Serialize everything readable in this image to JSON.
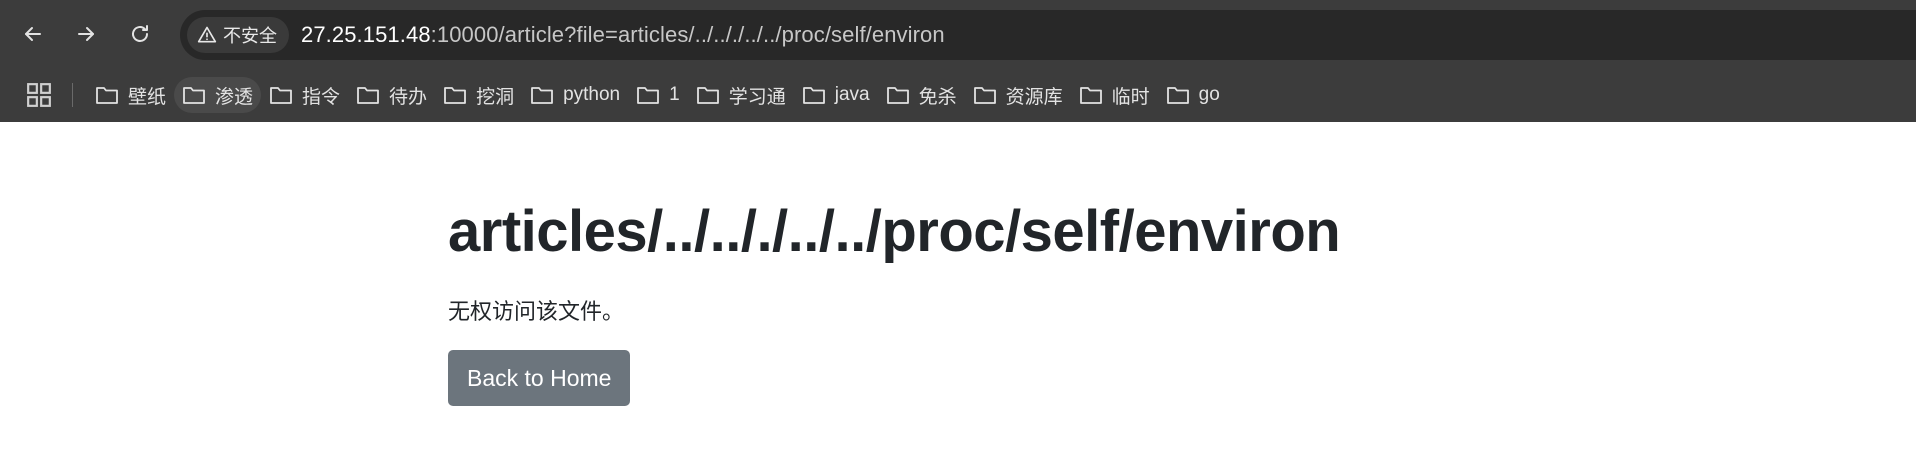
{
  "browser": {
    "security_label": "不安全",
    "url_host": "27.25.151.48",
    "url_rest": ":10000/article?file=articles/../.././../../proc/self/environ",
    "icons": {
      "back": "arrow-left-icon",
      "forward": "arrow-right-icon",
      "reload": "reload-icon",
      "security": "warning-triangle-icon",
      "apps": "apps-grid-icon",
      "folder": "folder-icon"
    },
    "colors": {
      "toolbar": "#3c3c3c",
      "omnibox": "#282828"
    }
  },
  "bookmarks": [
    {
      "label": "壁纸"
    },
    {
      "label": "渗透"
    },
    {
      "label": "指令"
    },
    {
      "label": "待办"
    },
    {
      "label": "挖洞"
    },
    {
      "label": "python"
    },
    {
      "label": "1"
    },
    {
      "label": "学习通"
    },
    {
      "label": "java"
    },
    {
      "label": "免杀"
    },
    {
      "label": "资源库"
    },
    {
      "label": "临时"
    },
    {
      "label": "go"
    }
  ],
  "page": {
    "heading": "articles/../.././../../proc/self/environ",
    "message": "无权访问该文件。",
    "back_button": "Back to Home",
    "colors": {
      "text": "#212529",
      "button": "#6c757d"
    }
  }
}
